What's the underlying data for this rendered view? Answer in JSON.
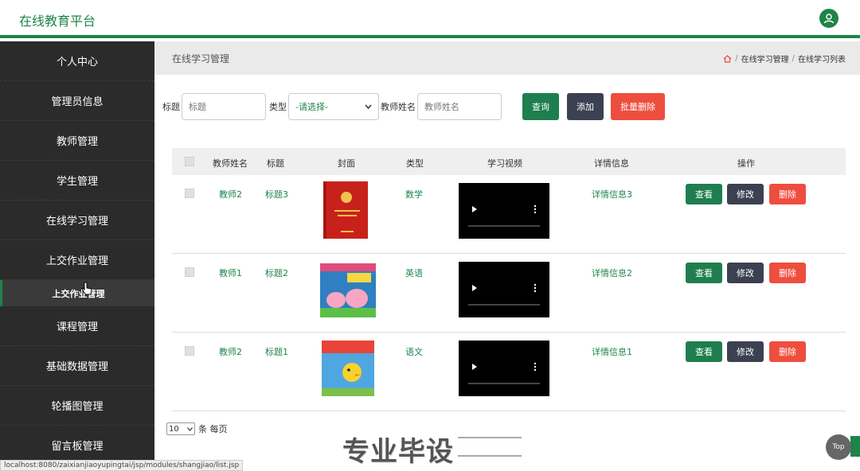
{
  "header": {
    "brand": "在线教育平台",
    "user_icon": "user-icon"
  },
  "sidebar": {
    "items": [
      "个人中心",
      "管理员信息",
      "教师管理",
      "学生管理",
      "在线学习管理",
      "上交作业管理"
    ],
    "active_sub": "上交作业管理",
    "items_after": [
      "课程管理",
      "基础数据管理",
      "轮播图管理",
      "留言板管理"
    ]
  },
  "page": {
    "title": "在线学习管理",
    "breadcrumb": [
      "在线学习管理",
      "在线学习列表"
    ]
  },
  "filters": {
    "title_label": "标题",
    "title_placeholder": "标题",
    "type_label": "类型",
    "type_selected": "-请选择-",
    "teacher_label": "教师姓名",
    "teacher_placeholder": "教师姓名",
    "search": "查询",
    "add": "添加",
    "batch_delete": "批量删除"
  },
  "table": {
    "headers": [
      "教师姓名",
      "标题",
      "封面",
      "类型",
      "学习视频",
      "详情信息",
      "操作"
    ],
    "rows": [
      {
        "teacher": "教师2",
        "title": "标题3",
        "type": "数学",
        "detail": "详情信息3",
        "cover": "red-book-cover"
      },
      {
        "teacher": "教师1",
        "title": "标题2",
        "type": "英语",
        "detail": "详情信息2",
        "cover": "peppa-book-cover"
      },
      {
        "teacher": "教师2",
        "title": "标题1",
        "type": "语文",
        "detail": "详情信息1",
        "cover": "duck-book-cover"
      }
    ],
    "actions": {
      "view": "查看",
      "edit": "修改",
      "delete": "删除"
    }
  },
  "pager": {
    "per_page": "10",
    "suffix": "条 每页"
  },
  "watermark": "专业毕设",
  "statusbar": "localhost:8080/zaixianjiaoyupingtai/jsp/modules/shangjiao/list.jsp",
  "top_button": "Top",
  "colors": {
    "primary": "#1e8449",
    "dark": "#3b4150",
    "danger": "#ee4e3e",
    "sidebar": "#2b2b2b"
  }
}
